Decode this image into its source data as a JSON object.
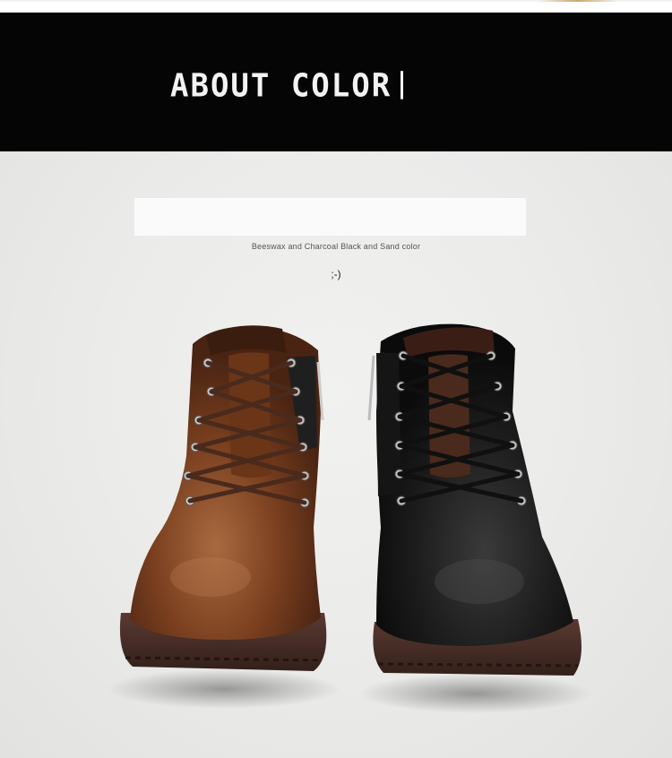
{
  "banner": {
    "title": "ABOUT COLOR"
  },
  "product": {
    "subtitle": "Beeswax and Charcoal Black and Sand color",
    "emoticon": ";-)"
  },
  "colors": {
    "banner_bg": "#050505",
    "brown_leather": "#7a3f1f",
    "black_leather": "#1c1c1c",
    "sole": "#4a2e27"
  }
}
